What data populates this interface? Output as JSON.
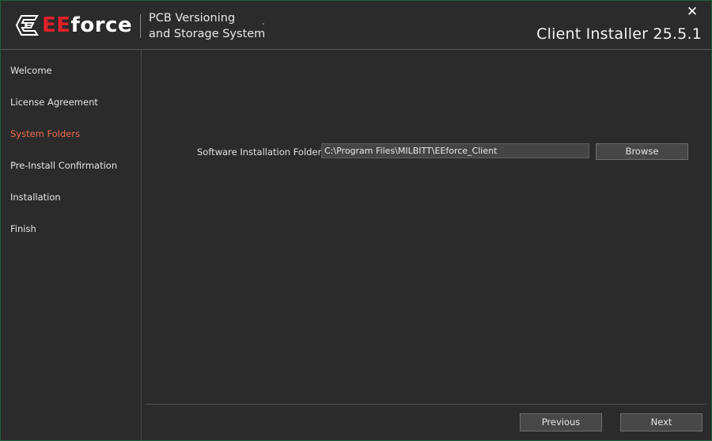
{
  "header": {
    "brand_ee": "EE",
    "brand_rest": "force",
    "subtitle_line1": "PCB Versioning",
    "subtitle_line2": "and Storage System",
    "dash": "-",
    "product_title": "Client Installer 25.5.1",
    "close_glyph": "✕",
    "logo_icon": "circuit-e-logo-icon",
    "brand_color": "#e0202a"
  },
  "sidebar": {
    "active_color": "#ef6a50",
    "items": [
      {
        "label": "Welcome"
      },
      {
        "label": "License Agreement"
      },
      {
        "label": "System Folders"
      },
      {
        "label": "Pre-Install Confirmation"
      },
      {
        "label": "Installation"
      },
      {
        "label": "Finish"
      }
    ]
  },
  "main": {
    "folder_label": "Software Installation Folder :",
    "folder_value": "C:\\Program Files\\MILBITT\\EEforce_Client",
    "browse_label": "Browse"
  },
  "footer": {
    "previous_label": "Previous",
    "next_label": "Next"
  }
}
